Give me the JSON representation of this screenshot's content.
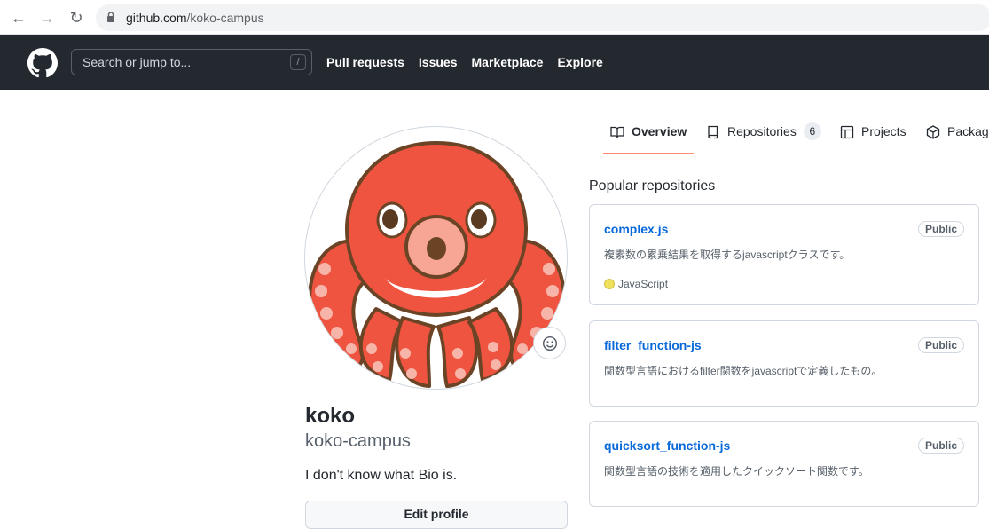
{
  "browser": {
    "url_host": "github.com",
    "url_path": "/koko-campus"
  },
  "header": {
    "search_placeholder": "Search or jump to...",
    "search_shortcut": "/",
    "nav": [
      "Pull requests",
      "Issues",
      "Marketplace",
      "Explore"
    ]
  },
  "tabs": {
    "overview": "Overview",
    "repositories": "Repositories",
    "repositories_count": "6",
    "projects": "Projects",
    "packages": "Packages"
  },
  "profile": {
    "name": "koko",
    "login": "koko-campus",
    "bio": "I don't know what Bio is.",
    "edit_button": "Edit profile"
  },
  "popular": {
    "title": "Popular repositories",
    "repos": [
      {
        "name": "complex.js",
        "visibility": "Public",
        "description": "複素数の累乗結果を取得するjavascriptクラスです。",
        "language": "JavaScript",
        "language_color": "#f1e05a"
      },
      {
        "name": "filter_function-js",
        "visibility": "Public",
        "description": "関数型言語におけるfilter関数をjavascriptで定義したもの。"
      },
      {
        "name": "quicksort_function-js",
        "visibility": "Public",
        "description": "関数型言語の技術を適用したクイックソート関数です。"
      }
    ]
  },
  "colors": {
    "header_bg": "#24292f",
    "link": "#0969da",
    "tab_underline": "#fd8c73",
    "octopus_red": "#ef5440"
  }
}
